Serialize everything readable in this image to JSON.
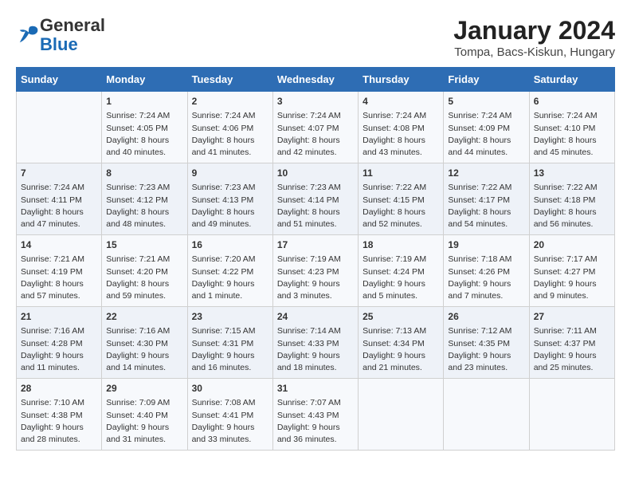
{
  "logo": {
    "general": "General",
    "blue": "Blue"
  },
  "title": "January 2024",
  "subtitle": "Tompa, Bacs-Kiskun, Hungary",
  "days_header": [
    "Sunday",
    "Monday",
    "Tuesday",
    "Wednesday",
    "Thursday",
    "Friday",
    "Saturday"
  ],
  "weeks": [
    [
      {
        "day": "",
        "content": ""
      },
      {
        "day": "1",
        "content": "Sunrise: 7:24 AM\nSunset: 4:05 PM\nDaylight: 8 hours\nand 40 minutes."
      },
      {
        "day": "2",
        "content": "Sunrise: 7:24 AM\nSunset: 4:06 PM\nDaylight: 8 hours\nand 41 minutes."
      },
      {
        "day": "3",
        "content": "Sunrise: 7:24 AM\nSunset: 4:07 PM\nDaylight: 8 hours\nand 42 minutes."
      },
      {
        "day": "4",
        "content": "Sunrise: 7:24 AM\nSunset: 4:08 PM\nDaylight: 8 hours\nand 43 minutes."
      },
      {
        "day": "5",
        "content": "Sunrise: 7:24 AM\nSunset: 4:09 PM\nDaylight: 8 hours\nand 44 minutes."
      },
      {
        "day": "6",
        "content": "Sunrise: 7:24 AM\nSunset: 4:10 PM\nDaylight: 8 hours\nand 45 minutes."
      }
    ],
    [
      {
        "day": "7",
        "content": "Sunrise: 7:24 AM\nSunset: 4:11 PM\nDaylight: 8 hours\nand 47 minutes."
      },
      {
        "day": "8",
        "content": "Sunrise: 7:23 AM\nSunset: 4:12 PM\nDaylight: 8 hours\nand 48 minutes."
      },
      {
        "day": "9",
        "content": "Sunrise: 7:23 AM\nSunset: 4:13 PM\nDaylight: 8 hours\nand 49 minutes."
      },
      {
        "day": "10",
        "content": "Sunrise: 7:23 AM\nSunset: 4:14 PM\nDaylight: 8 hours\nand 51 minutes."
      },
      {
        "day": "11",
        "content": "Sunrise: 7:22 AM\nSunset: 4:15 PM\nDaylight: 8 hours\nand 52 minutes."
      },
      {
        "day": "12",
        "content": "Sunrise: 7:22 AM\nSunset: 4:17 PM\nDaylight: 8 hours\nand 54 minutes."
      },
      {
        "day": "13",
        "content": "Sunrise: 7:22 AM\nSunset: 4:18 PM\nDaylight: 8 hours\nand 56 minutes."
      }
    ],
    [
      {
        "day": "14",
        "content": "Sunrise: 7:21 AM\nSunset: 4:19 PM\nDaylight: 8 hours\nand 57 minutes."
      },
      {
        "day": "15",
        "content": "Sunrise: 7:21 AM\nSunset: 4:20 PM\nDaylight: 8 hours\nand 59 minutes."
      },
      {
        "day": "16",
        "content": "Sunrise: 7:20 AM\nSunset: 4:22 PM\nDaylight: 9 hours\nand 1 minute."
      },
      {
        "day": "17",
        "content": "Sunrise: 7:19 AM\nSunset: 4:23 PM\nDaylight: 9 hours\nand 3 minutes."
      },
      {
        "day": "18",
        "content": "Sunrise: 7:19 AM\nSunset: 4:24 PM\nDaylight: 9 hours\nand 5 minutes."
      },
      {
        "day": "19",
        "content": "Sunrise: 7:18 AM\nSunset: 4:26 PM\nDaylight: 9 hours\nand 7 minutes."
      },
      {
        "day": "20",
        "content": "Sunrise: 7:17 AM\nSunset: 4:27 PM\nDaylight: 9 hours\nand 9 minutes."
      }
    ],
    [
      {
        "day": "21",
        "content": "Sunrise: 7:16 AM\nSunset: 4:28 PM\nDaylight: 9 hours\nand 11 minutes."
      },
      {
        "day": "22",
        "content": "Sunrise: 7:16 AM\nSunset: 4:30 PM\nDaylight: 9 hours\nand 14 minutes."
      },
      {
        "day": "23",
        "content": "Sunrise: 7:15 AM\nSunset: 4:31 PM\nDaylight: 9 hours\nand 16 minutes."
      },
      {
        "day": "24",
        "content": "Sunrise: 7:14 AM\nSunset: 4:33 PM\nDaylight: 9 hours\nand 18 minutes."
      },
      {
        "day": "25",
        "content": "Sunrise: 7:13 AM\nSunset: 4:34 PM\nDaylight: 9 hours\nand 21 minutes."
      },
      {
        "day": "26",
        "content": "Sunrise: 7:12 AM\nSunset: 4:35 PM\nDaylight: 9 hours\nand 23 minutes."
      },
      {
        "day": "27",
        "content": "Sunrise: 7:11 AM\nSunset: 4:37 PM\nDaylight: 9 hours\nand 25 minutes."
      }
    ],
    [
      {
        "day": "28",
        "content": "Sunrise: 7:10 AM\nSunset: 4:38 PM\nDaylight: 9 hours\nand 28 minutes."
      },
      {
        "day": "29",
        "content": "Sunrise: 7:09 AM\nSunset: 4:40 PM\nDaylight: 9 hours\nand 31 minutes."
      },
      {
        "day": "30",
        "content": "Sunrise: 7:08 AM\nSunset: 4:41 PM\nDaylight: 9 hours\nand 33 minutes."
      },
      {
        "day": "31",
        "content": "Sunrise: 7:07 AM\nSunset: 4:43 PM\nDaylight: 9 hours\nand 36 minutes."
      },
      {
        "day": "",
        "content": ""
      },
      {
        "day": "",
        "content": ""
      },
      {
        "day": "",
        "content": ""
      }
    ]
  ]
}
